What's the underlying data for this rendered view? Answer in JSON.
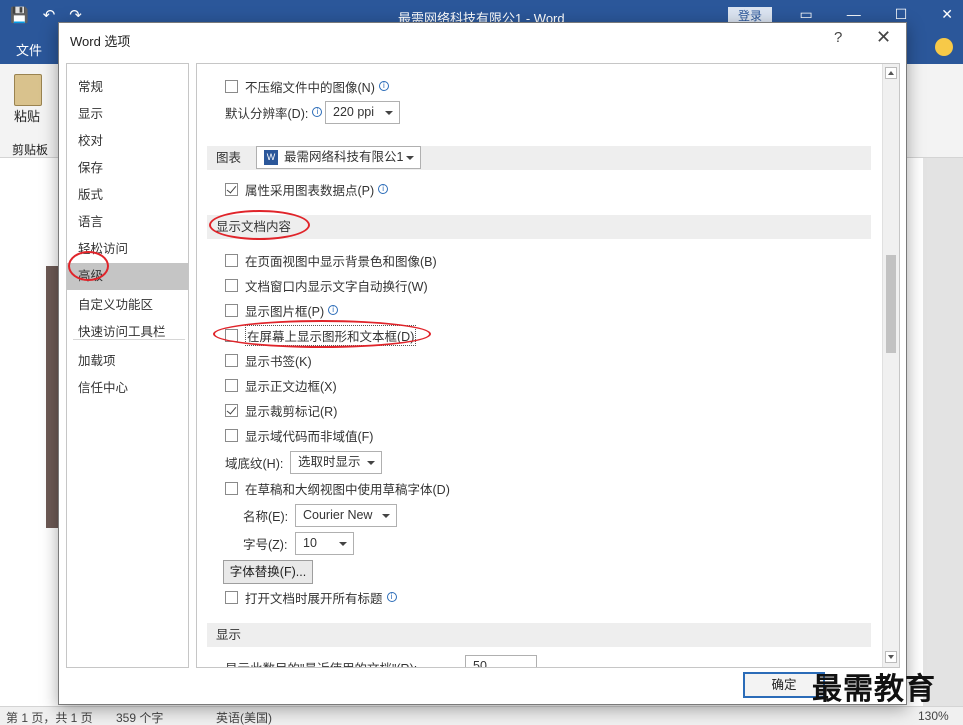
{
  "word_window": {
    "title": "最需网络科技有限公1 - Word",
    "signin": "登录",
    "file_tab": "文件",
    "paste_label": "粘贴",
    "clipboard_label": "剪贴板",
    "status": {
      "page": "第 1 页，共 1 页",
      "words": "359 个字",
      "language": "英语(美国)",
      "zoom": "130%"
    }
  },
  "dialog": {
    "title": "Word 选项",
    "help": "?",
    "close": "✕",
    "ok_label": "确定"
  },
  "nav": {
    "items": [
      "常规",
      "显示",
      "校对",
      "保存",
      "版式",
      "语言",
      "轻松访问",
      "高级",
      "自定义功能区",
      "快速访问工具栏",
      "加载项",
      "信任中心"
    ],
    "active": "高级"
  },
  "content": {
    "top_partial": "不压缩文件中的图像(N)",
    "resolution_label": "默认分辨率(D):",
    "resolution_value": "220 ppi",
    "chart_section": "图表",
    "chart_doc": "最需网络科技有限公1",
    "chart_option": "属性采用图表数据点(P)",
    "display_section": "显示文档内容",
    "options": [
      {
        "label": "在页面视图中显示背景色和图像(B)",
        "checked": false
      },
      {
        "label": "文档窗口内显示文字自动换行(W)",
        "checked": false
      },
      {
        "label": "显示图片框(P)",
        "checked": false
      },
      {
        "label": "在屏幕上显示图形和文本框(D)",
        "checked": false
      },
      {
        "label": "显示书签(K)",
        "checked": false
      },
      {
        "label": "显示正文边框(X)",
        "checked": false
      },
      {
        "label": "显示裁剪标记(R)",
        "checked": true
      },
      {
        "label": "显示域代码而非域值(F)",
        "checked": false
      }
    ],
    "field_shading_label": "域底纹(H):",
    "field_shading_value": "选取时显示",
    "draft_font_option": "在草稿和大纲视图中使用草稿字体(D)",
    "font_name_label": "名称(E):",
    "font_name_value": "Courier New",
    "font_size_label": "字号(Z):",
    "font_size_value": "10",
    "font_substitution_button": "字体替换(F)...",
    "expand_headings_option": "打开文档时展开所有标题",
    "show_section": "显示",
    "recent_docs_partial": "显示此数目的\"最近使用的文档\"(R):",
    "recent_docs_value": "50"
  },
  "watermark": "最需教育",
  "colors": {
    "accent": "#2b579a",
    "highlight": "#e0242a"
  }
}
